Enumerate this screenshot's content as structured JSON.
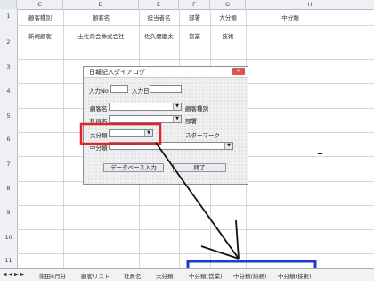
{
  "columns": [
    "C",
    "D",
    "E",
    "F",
    "G",
    "H"
  ],
  "rows": [
    "1",
    "2",
    "3",
    "4",
    "5",
    "6",
    "7",
    "8",
    "9",
    "10",
    "11"
  ],
  "header_cells": {
    "c": "顧客種別",
    "d": "顧客名",
    "e": "担当者名",
    "f": "部署",
    "g": "大分類",
    "h": "中分類"
  },
  "row2_cells": {
    "c": "新規顧客",
    "d": "土佐商会株式会社",
    "e": "佐久間慶太",
    "f": "営業",
    "g": "技術"
  },
  "dialog": {
    "title": "日報記入ダイアログ",
    "close_glyph": "✕",
    "input_no_label": "入力No",
    "input_date_label": "入力日",
    "customer_name_label": "顧客名",
    "customer_type_label": "顧客種別",
    "staff_name_label": "社員名",
    "department_label": "部署",
    "major_category_label": "大分類",
    "star_mark_label": "スターマーク",
    "middle_category_label": "中分類",
    "database_input_button": "データベース入力",
    "finish_button": "終了",
    "dropdown_glyph": "▼"
  },
  "sheet_tabs": {
    "nav_glyphs": "◄ ◄ ► ►",
    "items": [
      "柴田6月分",
      "顧客リスト",
      "社員名",
      "大分類",
      "中分類(営業)",
      "中分類(総務)",
      "中分類(技術)"
    ]
  },
  "colors": {
    "red_highlight": "#e0242c",
    "blue_highlight": "#1f39d6"
  }
}
